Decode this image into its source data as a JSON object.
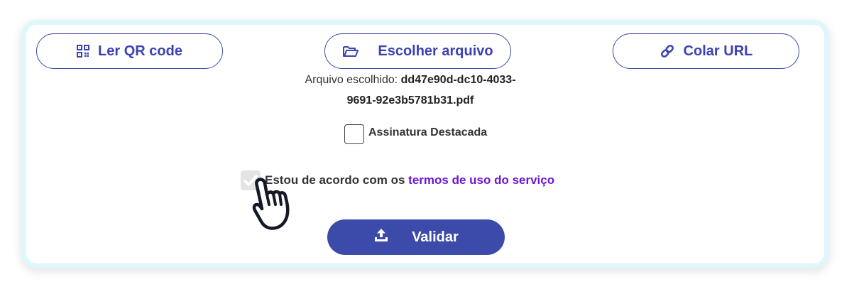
{
  "buttons": {
    "qr_label": "Ler QR code",
    "file_label": "Escolher arquivo",
    "url_label": "Colar URL"
  },
  "file": {
    "prefix": "Arquivo escolhido: ",
    "name_line1": "dd47e90d-dc10-4033-",
    "name_line2": "9691-92e3b5781b31.pdf"
  },
  "options": {
    "detached_label": "Assinatura Destacada",
    "detached_checked": false,
    "terms_prefix": "Estou de acordo com os ",
    "terms_link": "termos de uso do serviço",
    "terms_checked": true
  },
  "actions": {
    "validate_label": "Validar"
  },
  "icons": {
    "qr": "qr-code-icon",
    "file": "folder-open-icon",
    "url": "link-icon",
    "upload": "upload-icon",
    "cursor": "hand-pointer-cursor-icon"
  },
  "colors": {
    "primary": "#3c4ba9",
    "button_text": "#3d42b3",
    "link": "#6a16d6",
    "card_border": "#dff6fb"
  }
}
